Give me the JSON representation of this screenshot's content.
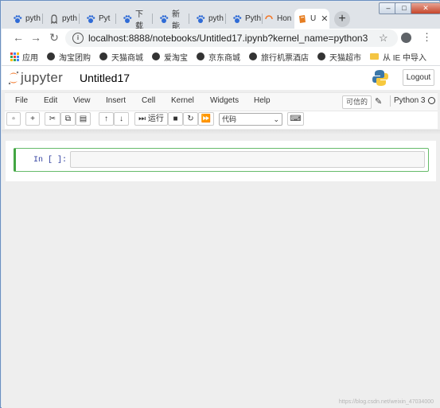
{
  "browser": {
    "tabs": [
      {
        "label": "pyth",
        "icon": "paw-icon",
        "color": "#2f6bd6"
      },
      {
        "label": "pyth",
        "icon": "ghost-icon",
        "color": "#555555"
      },
      {
        "label": "Pyt",
        "icon": "paw-icon",
        "color": "#2f6bd6"
      },
      {
        "label": "下载",
        "icon": "paw-icon",
        "color": "#2f6bd6"
      },
      {
        "label": "新能",
        "icon": "paw-icon",
        "color": "#2f6bd6"
      },
      {
        "label": "pyth",
        "icon": "paw-icon",
        "color": "#2f6bd6"
      },
      {
        "label": "Pyth",
        "icon": "paw-icon",
        "color": "#2f6bd6"
      },
      {
        "label": "Hon",
        "icon": "jupyter-spinner-icon",
        "color": "#f37626"
      },
      {
        "label": "U",
        "icon": "notebook-icon",
        "color": "#e67e22",
        "active": true
      }
    ],
    "new_tab": "+",
    "window_controls": {
      "min": "–",
      "max": "□",
      "close": "✕"
    },
    "url": "localhost:8888/notebooks/Untitled17.ipynb?kernel_name=python3",
    "bookmarks": [
      {
        "label": "应用",
        "icon": "apps-grid-icon"
      },
      {
        "label": "淘宝团购",
        "icon": "globe-icon"
      },
      {
        "label": "天猫商城",
        "icon": "globe-icon"
      },
      {
        "label": "爱淘宝",
        "icon": "globe-icon"
      },
      {
        "label": "京东商城",
        "icon": "globe-icon"
      },
      {
        "label": "旅行机票酒店",
        "icon": "globe-icon"
      },
      {
        "label": "天猫超市",
        "icon": "globe-icon"
      },
      {
        "label": "从 IE 中导入",
        "icon": "folder-icon"
      }
    ]
  },
  "jupyter": {
    "logo_text": "jupyter",
    "notebook_name": "Untitled17",
    "logout": "Logout",
    "menu": [
      "File",
      "Edit",
      "View",
      "Insert",
      "Cell",
      "Kernel",
      "Widgets",
      "Help"
    ],
    "trusted": "可信的",
    "kernel": "Python 3",
    "run_label": "运行",
    "cell_type": "代码",
    "prompt": "In [ ]:",
    "accent": "#f37626",
    "cell_border": "#66bb6a"
  },
  "watermark": "https://blog.csdn.net/weixin_47034000"
}
